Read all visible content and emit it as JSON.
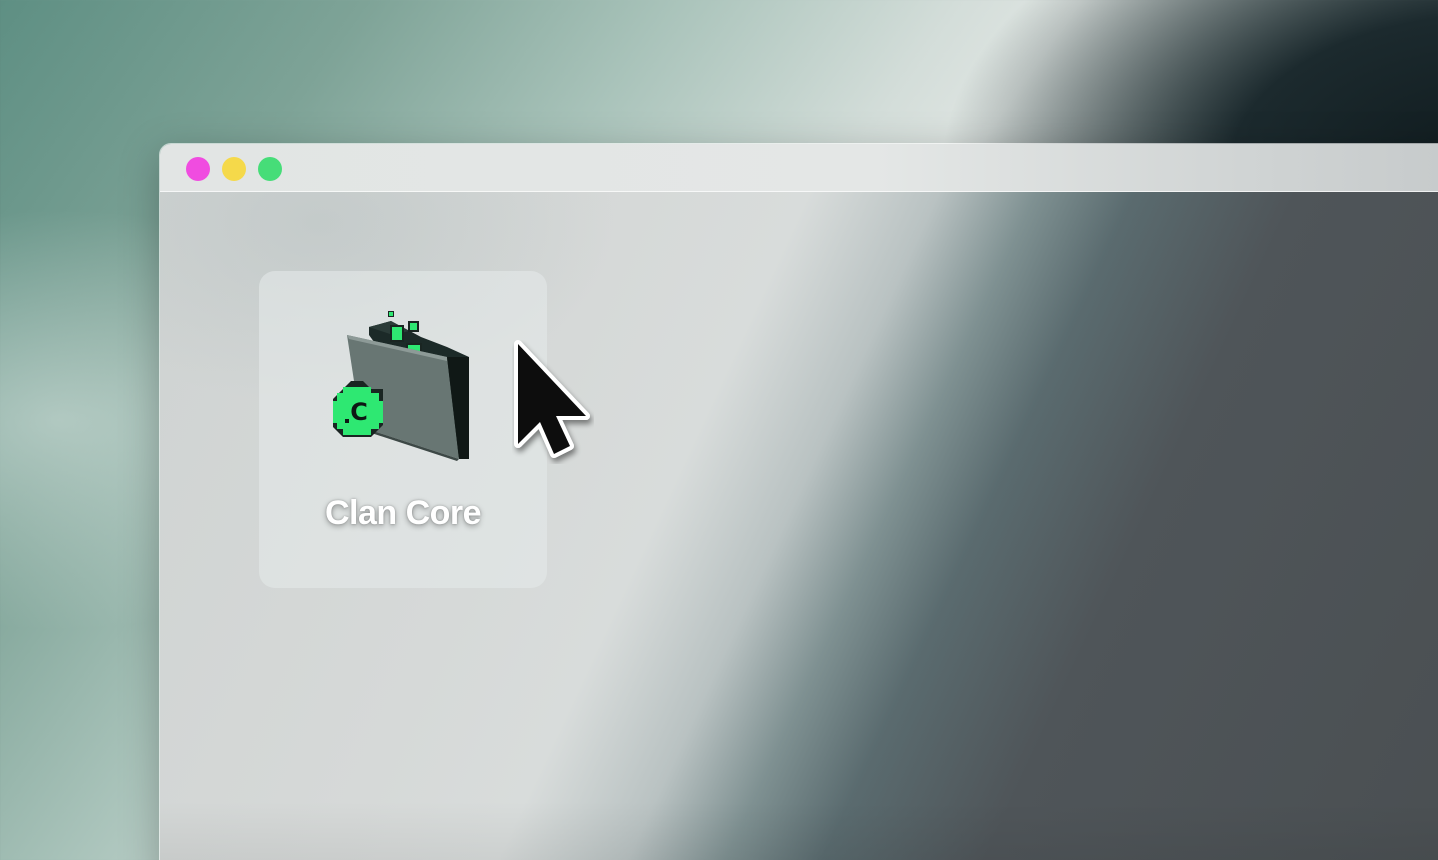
{
  "window": {
    "controls": {
      "close_color": "#f04ce0",
      "minimize_color": "#f5d94a",
      "maximize_color": "#46dd78"
    }
  },
  "desktop_item": {
    "label": "Clan Core",
    "icon": "clan-folder-icon",
    "badge_letter": "C",
    "accent_color": "#2ee872"
  },
  "cursor": {
    "icon": "arrow-cursor-icon"
  }
}
